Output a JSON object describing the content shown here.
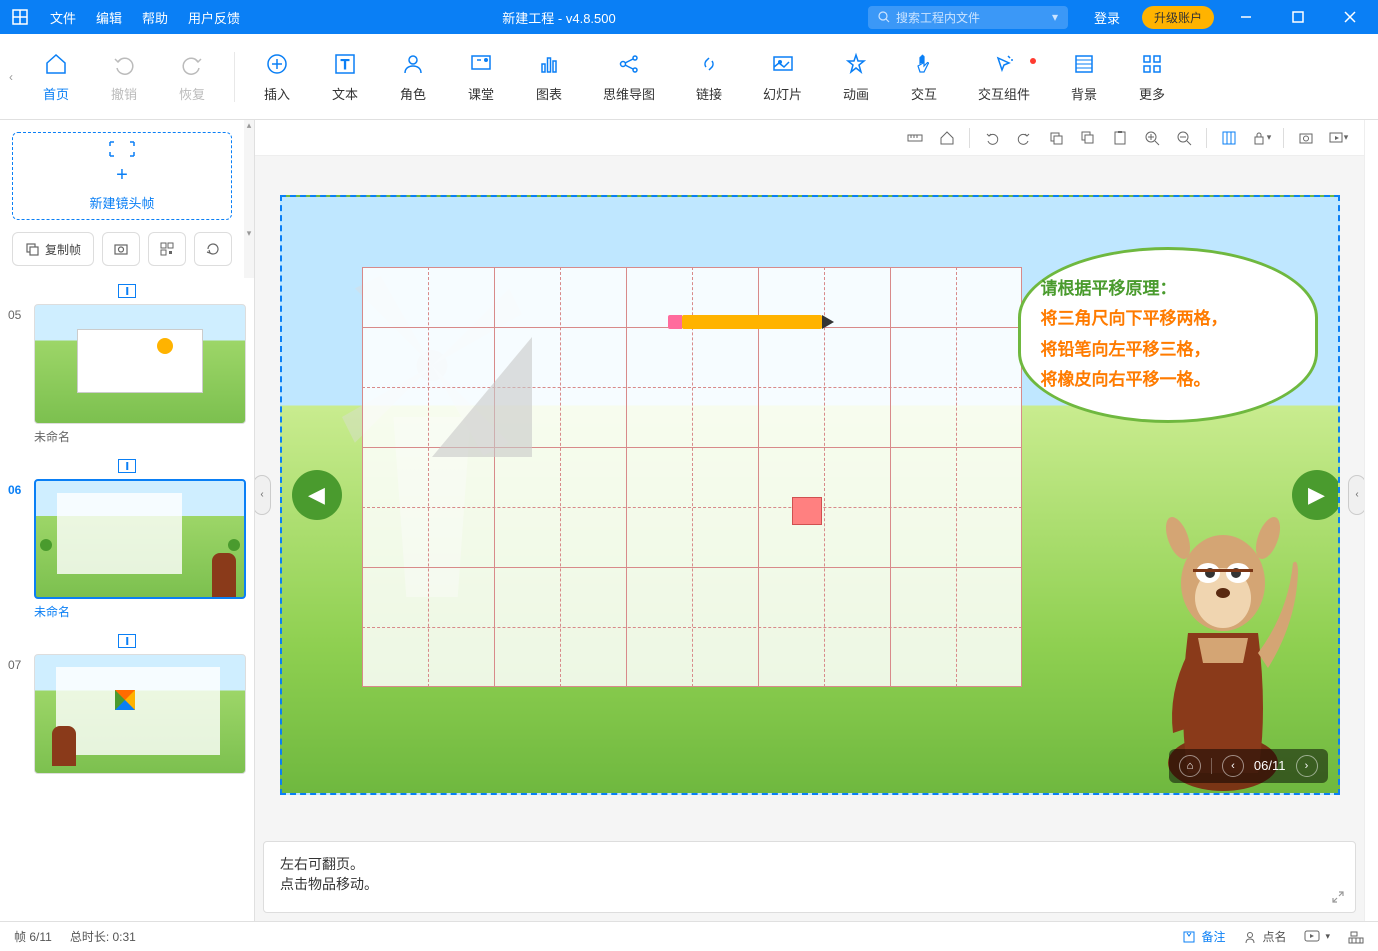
{
  "titlebar": {
    "menus": {
      "file": "文件",
      "edit": "编辑",
      "help": "帮助",
      "feedback": "用户反馈"
    },
    "title": "新建工程 - v4.8.500",
    "search_placeholder": "搜索工程内文件",
    "login": "登录",
    "upgrade": "升级账户"
  },
  "ribbon": {
    "home": "首页",
    "undo": "撤销",
    "redo": "恢复",
    "insert": "插入",
    "text": "文本",
    "role": "角色",
    "class": "课堂",
    "chart": "图表",
    "mindmap": "思维导图",
    "link": "链接",
    "slide": "幻灯片",
    "anim": "动画",
    "interact": "交互",
    "widget": "交互组件",
    "bg": "背景",
    "more": "更多"
  },
  "left": {
    "new_frame": "新建镜头帧",
    "copy_frame": "复制帧",
    "thumbs": [
      {
        "num": "05",
        "label": "未命名"
      },
      {
        "num": "06",
        "label": "未命名"
      },
      {
        "num": "07",
        "label": ""
      }
    ]
  },
  "slide": {
    "speech": {
      "line1": "请根据平移原理：",
      "line2": "将三角尺向下平移两格，",
      "line3": "将铅笔向左平移三格，",
      "line4": "将橡皮向右平移一格。"
    },
    "counter": "06/11"
  },
  "notes": {
    "line1": "左右可翻页。",
    "line2": "点击物品移动。"
  },
  "status": {
    "frame": "帧 6/11",
    "duration": "总时长: 0:31",
    "remark": "备注",
    "roll": "点名"
  }
}
